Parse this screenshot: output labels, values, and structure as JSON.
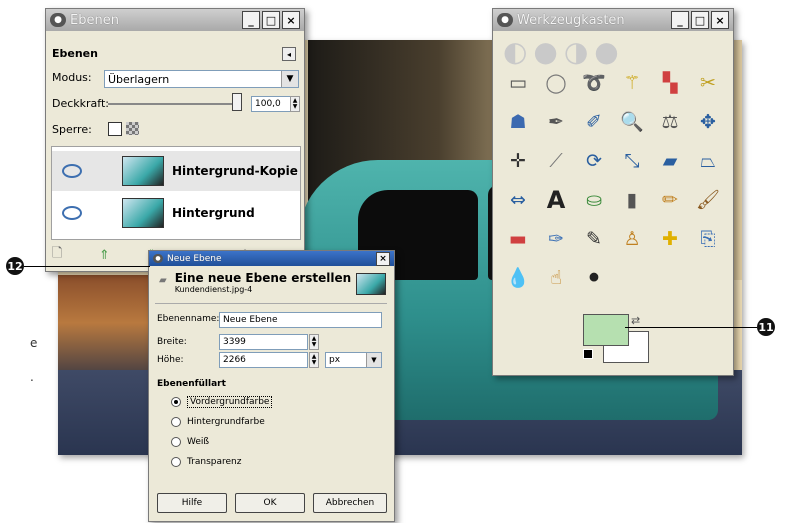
{
  "layers_dialog": {
    "title": "Ebenen",
    "section_title": "Ebenen",
    "mode_label": "Modus:",
    "mode_value": "Überlagern",
    "opacity_label": "Deckkraft:",
    "opacity_value": "100,0",
    "lock_label": "Sperre:",
    "layers": [
      {
        "name": "Hintergrund-Kopie"
      },
      {
        "name": "Hintergrund"
      }
    ]
  },
  "toolbox": {
    "title": "Werkzeugkasten",
    "fg_color": "#b6e0b0",
    "bg_color": "#ffffff"
  },
  "new_layer_dialog": {
    "title": "Neue Ebene",
    "heading": "Eine neue Ebene erstellen",
    "subheading": "Kundendienst.jpg-4",
    "name_label": "Ebenenname:",
    "name_value": "Neue Ebene",
    "width_label": "Breite:",
    "width_value": "3399",
    "height_label": "Höhe:",
    "height_value": "2266",
    "unit_value": "px",
    "fill_label": "Ebenenfüllart",
    "fill_options": [
      {
        "label": "Vordergrundfarbe",
        "selected": true
      },
      {
        "label": "Hintergrundfarbe",
        "selected": false
      },
      {
        "label": "Weiß",
        "selected": false
      },
      {
        "label": "Transparenz",
        "selected": false
      }
    ],
    "help_button": "Hilfe",
    "ok_button": "OK",
    "cancel_button": "Abbrechen"
  },
  "callouts": {
    "c11": "11",
    "c12": "12"
  },
  "side_text": {
    "line1": "e",
    "line2": "."
  }
}
